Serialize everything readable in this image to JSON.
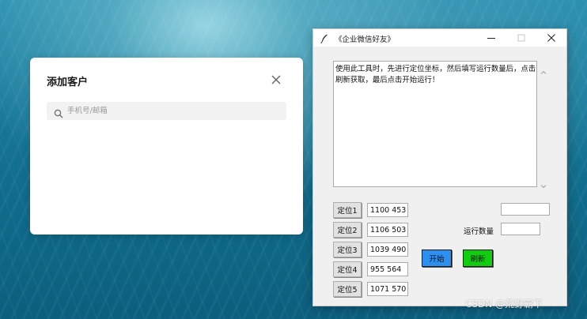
{
  "add_customer_card": {
    "title": "添加客户",
    "search": {
      "placeholder": "手机号/邮箱",
      "value": ""
    }
  },
  "tool_window": {
    "title": "《企业微信好友》",
    "instructions": "使用此工具时，先进行定位坐标，然后填写运行数量后，点击刷新获取，最后点击开始运行！",
    "locators": [
      {
        "button_label": "定位1",
        "value": "1100 453"
      },
      {
        "button_label": "定位2",
        "value": "1106 503"
      },
      {
        "button_label": "定位3",
        "value": "1039 490"
      },
      {
        "button_label": "定位4",
        "value": "955 564"
      },
      {
        "button_label": "定位5",
        "value": "1071 570"
      }
    ],
    "top_right_field_value": "",
    "run_count_label": "运行数量",
    "run_count_value": "",
    "start_label": "开始",
    "refresh_label": "刷新",
    "colors": {
      "start_button": "#2d8ff0",
      "refresh_button": "#11cc11"
    }
  },
  "watermark": "CSDN @荒野霸下"
}
